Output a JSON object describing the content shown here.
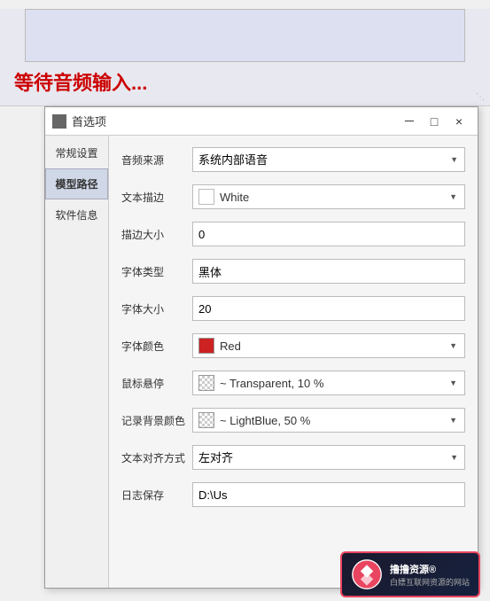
{
  "topArea": {
    "waitingText": "等待音频输入...",
    "resizeIcon": "⟘"
  },
  "dialog": {
    "titlebarIcon": "■",
    "title": "首选项",
    "minBtn": "－",
    "maxBtn": "□",
    "closeBtn": "×",
    "sidebar": {
      "items": [
        {
          "label": "常规设置",
          "active": false
        },
        {
          "label": "模型路径",
          "active": true
        },
        {
          "label": "软件信息",
          "active": false
        }
      ]
    },
    "form": {
      "rows": [
        {
          "label": "音频来源",
          "type": "dropdown",
          "value": "系统内部语音",
          "color": null
        },
        {
          "label": "文本描边",
          "type": "color-dropdown",
          "value": "White",
          "color": "#ffffff",
          "colorType": "solid"
        },
        {
          "label": "描边大小",
          "type": "input",
          "value": "0"
        },
        {
          "label": "字体类型",
          "type": "input",
          "value": "黑体"
        },
        {
          "label": "字体大小",
          "type": "input",
          "value": "20"
        },
        {
          "label": "字体颜色",
          "type": "color-dropdown",
          "value": "Red",
          "color": "#cc2222",
          "colorType": "solid"
        },
        {
          "label": "鼠标悬停",
          "type": "color-dropdown",
          "value": "~ Transparent, 10 %",
          "color": null,
          "colorType": "checkered"
        },
        {
          "label": "记录背景颜色",
          "type": "color-dropdown",
          "value": "~ LightBlue, 50 %",
          "color": null,
          "colorType": "checkered"
        },
        {
          "label": "文本对齐方式",
          "type": "dropdown",
          "value": "左对齐"
        },
        {
          "label": "日志保存",
          "type": "input",
          "value": "D:\\Us"
        }
      ]
    }
  },
  "watermark": {
    "line1": "撸撸资源®",
    "line2": "白嫖互联网资源的网站"
  }
}
